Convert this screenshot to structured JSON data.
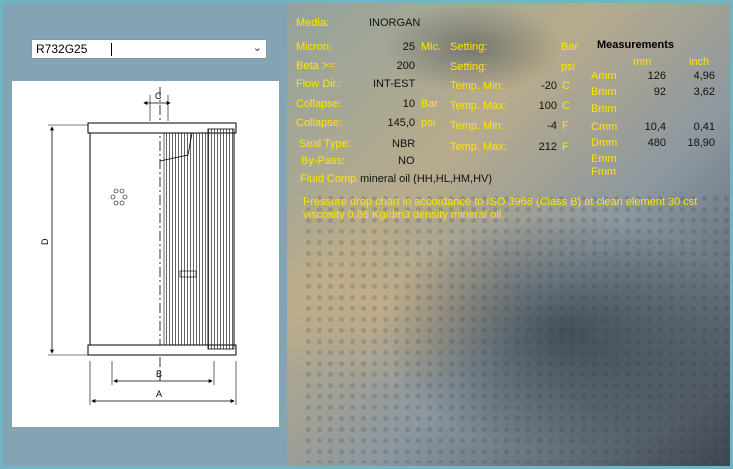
{
  "code_select": {
    "value": "R732G25"
  },
  "drawing": {
    "labels": {
      "c": "C",
      "d": "D",
      "b": "B",
      "a": "A"
    }
  },
  "specs": {
    "media": {
      "label": "Media:",
      "value": "INORGAN"
    },
    "micron": {
      "label": "Micron:",
      "value": "25",
      "unit": "Mic."
    },
    "beta": {
      "label": "Beta >=:",
      "value": "200"
    },
    "flow_dir": {
      "label": "Flow Dir.:",
      "value": "INT-EST"
    },
    "collapse_bar": {
      "label": "Collapse:",
      "value": "10",
      "unit": "Bar"
    },
    "collapse_psi": {
      "label": "Collapse:",
      "value": "145,0",
      "unit": "psi"
    },
    "seal_type": {
      "label": "Seal Type:",
      "value": "NBR"
    },
    "by_pass": {
      "label": "By-Pass:",
      "value": "NO"
    },
    "fluid_comp": {
      "label": "Fluid Comp.:",
      "value": "mineral oil (HH,HL,HM,HV)"
    }
  },
  "settings": {
    "setting_bar": {
      "label": "Setting:",
      "unit": "Bar"
    },
    "setting_psi": {
      "label": "Setting:",
      "unit": "psi"
    },
    "temp_min_c": {
      "label": "Temp. Min:",
      "value": "-20",
      "unit": "C"
    },
    "temp_max_c": {
      "label": "Temp. Max:",
      "value": "100",
      "unit": "C"
    },
    "temp_min_f": {
      "label": "Temp. Min:",
      "value": "-4",
      "unit": "F"
    },
    "temp_max_f": {
      "label": "Temp. Max:",
      "value": "212",
      "unit": "F"
    }
  },
  "note": "Pressure drop chart in accordance to ISO 3968 (Class B) at clean element 30 cst viscosity 0,86 Kg/dm3 density mineral oil.",
  "measurements": {
    "title": "Measurements",
    "col_mm": "mm",
    "col_inch": "inch",
    "rows": [
      {
        "label": "Amm",
        "mm": "126",
        "inch": "4,96"
      },
      {
        "label": "Bmm",
        "mm": "92",
        "inch": "3,62"
      },
      {
        "label": "Bmm",
        "mm": "",
        "inch": ""
      },
      {
        "label": "Cmm",
        "mm": "10,4",
        "inch": "0,41"
      },
      {
        "label": "Dmm",
        "mm": "480",
        "inch": "18,90"
      },
      {
        "label": "Emm",
        "mm": "",
        "inch": ""
      },
      {
        "label": "Fmm",
        "mm": "",
        "inch": ""
      }
    ]
  },
  "colors": {
    "label_yellow": "#ffe600",
    "panel_blue": "#84a4b6",
    "frame": "#6fb6c4"
  }
}
